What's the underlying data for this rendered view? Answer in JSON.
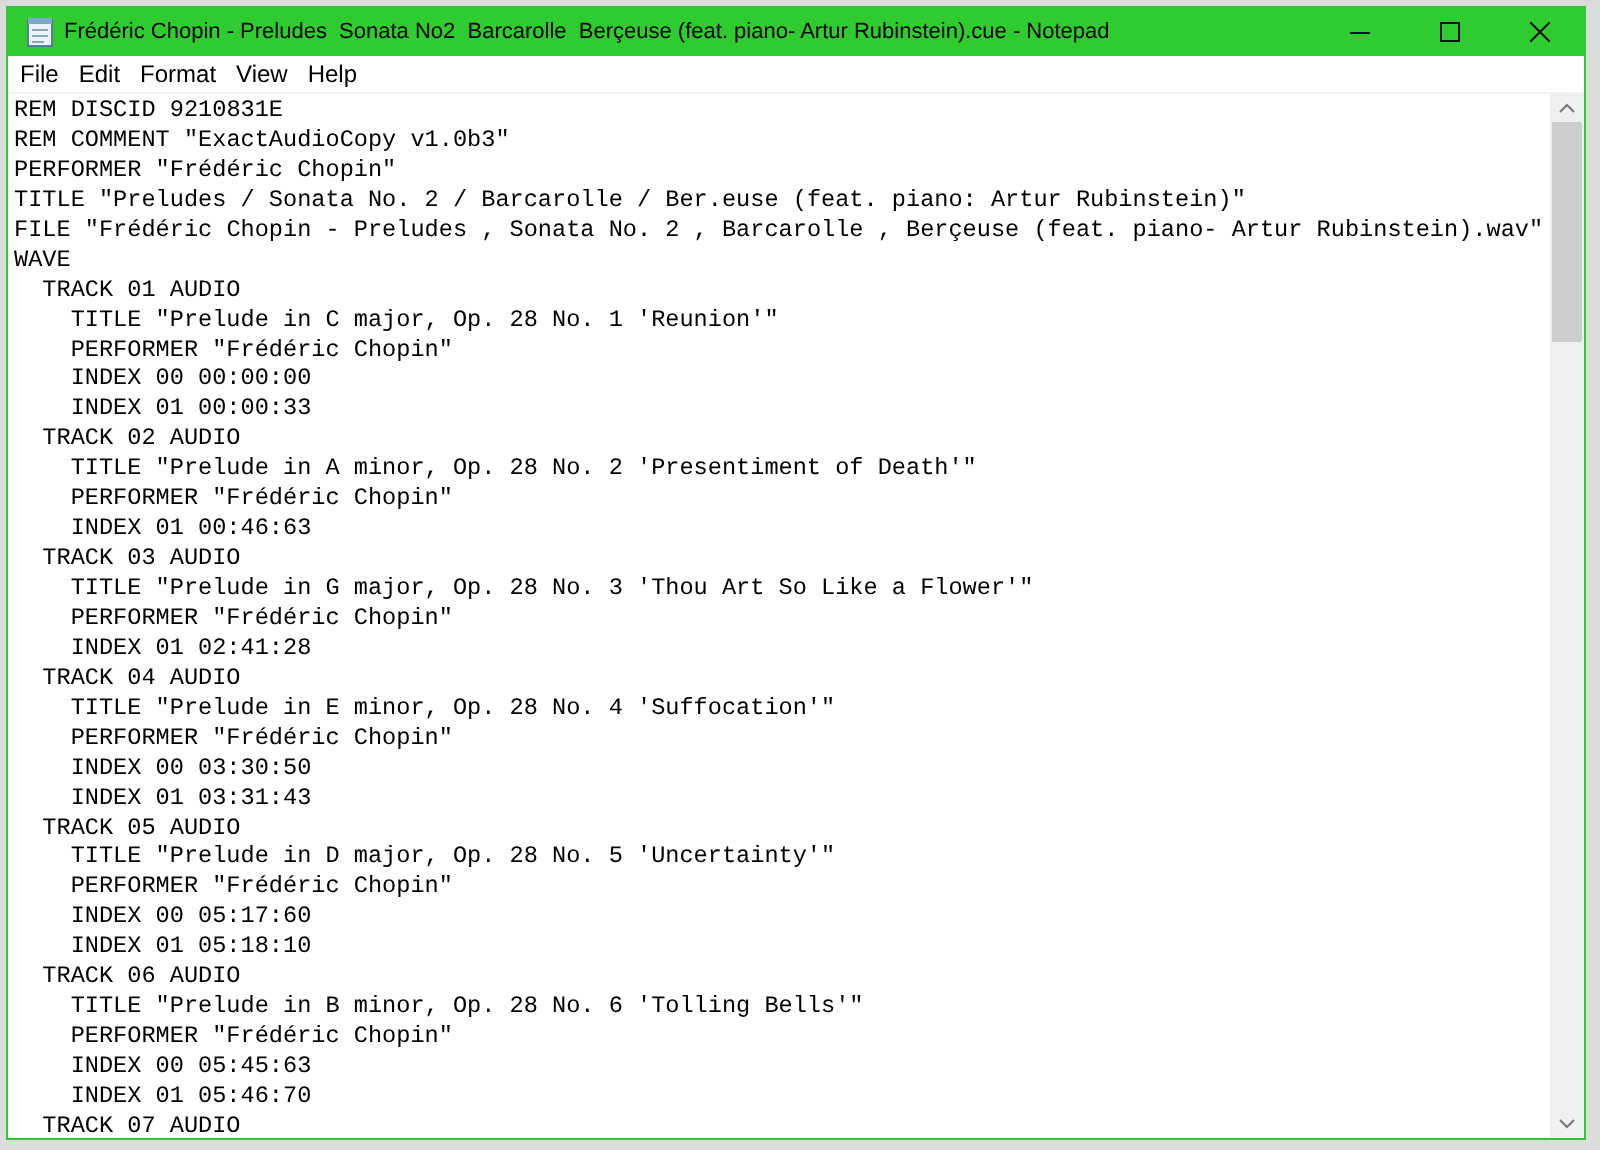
{
  "window": {
    "title": "Frédéric Chopin - Preludes  Sonata No2  Barcarolle  Berçeuse (feat. piano- Artur Rubinstein).cue - Notepad"
  },
  "menu": [
    {
      "label": "File"
    },
    {
      "label": "Edit"
    },
    {
      "label": "Format"
    },
    {
      "label": "View"
    },
    {
      "label": "Help"
    }
  ],
  "lines": [
    {
      "text": "REM DISCID 9210831E"
    },
    {
      "text": "REM COMMENT \"ExactAudioCopy v1.0b3\""
    },
    {
      "text": "PERFORMER \"Frédéric Chopin\""
    },
    {
      "text": "TITLE \"Preludes / Sonata No. 2 / Barcarolle / Ber.euse (feat. piano: Artur Rubinstein)\""
    },
    {
      "text": "FILE \"Frédéric Chopin - Preludes , Sonata No. 2 , Barcarolle , Berçeuse (feat. piano- Artur Rubinstein).wav\""
    },
    {
      "text": "WAVE",
      "children": [
        {
          "text": "TRACK 01 AUDIO",
          "children": [
            {
              "text": "TITLE \"Prelude in C major, Op. 28 No. 1 'Reunion'\""
            },
            {
              "text": "PERFORMER \"Frédéric Chopin\""
            },
            {
              "text": "INDEX 00 00:00:00"
            },
            {
              "text": "INDEX 01 00:00:33"
            }
          ]
        },
        {
          "text": "TRACK 02 AUDIO",
          "children": [
            {
              "text": "TITLE \"Prelude in A minor, Op. 28 No. 2 'Presentiment of Death'\""
            },
            {
              "text": "PERFORMER \"Frédéric Chopin\""
            },
            {
              "text": "INDEX 01 00:46:63"
            }
          ]
        },
        {
          "text": "TRACK 03 AUDIO",
          "children": [
            {
              "text": "TITLE \"Prelude in G major, Op. 28 No. 3 'Thou Art So Like a Flower'\""
            },
            {
              "text": "PERFORMER \"Frédéric Chopin\""
            },
            {
              "text": "INDEX 01 02:41:28"
            }
          ]
        },
        {
          "text": "TRACK 04 AUDIO",
          "children": [
            {
              "text": "TITLE \"Prelude in E minor, Op. 28 No. 4 'Suffocation'\""
            },
            {
              "text": "PERFORMER \"Frédéric Chopin\""
            },
            {
              "text": "INDEX 00 03:30:50"
            },
            {
              "text": "INDEX 01 03:31:43"
            }
          ]
        },
        {
          "text": "TRACK 05 AUDIO",
          "children": [
            {
              "text": "TITLE \"Prelude in D major, Op. 28 No. 5 'Uncertainty'\""
            },
            {
              "text": "PERFORMER \"Frédéric Chopin\""
            },
            {
              "text": "INDEX 00 05:17:60"
            },
            {
              "text": "INDEX 01 05:18:10"
            }
          ]
        },
        {
          "text": "TRACK 06 AUDIO",
          "children": [
            {
              "text": "TITLE \"Prelude in B minor, Op. 28 No. 6 'Tolling Bells'\""
            },
            {
              "text": "PERFORMER \"Frédéric Chopin\""
            },
            {
              "text": "INDEX 00 05:45:63"
            },
            {
              "text": "INDEX 01 05:46:70"
            }
          ]
        },
        {
          "text": "TRACK 07 AUDIO"
        }
      ]
    }
  ]
}
